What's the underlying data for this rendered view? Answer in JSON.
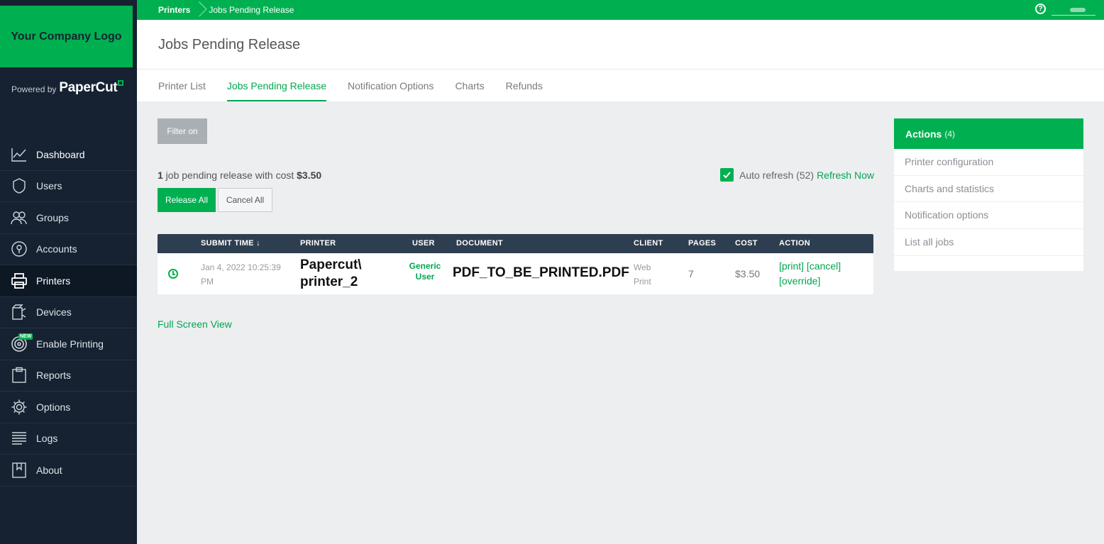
{
  "branding": {
    "logo_text": "Your Company Logo",
    "powered_by": "Powered by",
    "product": "PaperCut",
    "accent_color": "#00b050",
    "sidebar_color": "#162232"
  },
  "sidebar": {
    "items": [
      {
        "label": "Dashboard",
        "icon": "dashboard-chart-icon"
      },
      {
        "label": "Users",
        "icon": "user-shield-icon"
      },
      {
        "label": "Groups",
        "icon": "groups-icon"
      },
      {
        "label": "Accounts",
        "icon": "accounts-coin-icon"
      },
      {
        "label": "Printers",
        "icon": "printer-icon",
        "active": true
      },
      {
        "label": "Devices",
        "icon": "device-icon"
      },
      {
        "label": "Enable Printing",
        "icon": "target-icon",
        "badge": "NEW"
      },
      {
        "label": "Reports",
        "icon": "clipboard-icon"
      },
      {
        "label": "Options",
        "icon": "gear-icon"
      },
      {
        "label": "Logs",
        "icon": "list-lines-icon"
      },
      {
        "label": "About",
        "icon": "bookmark-icon"
      }
    ]
  },
  "topbar": {
    "breadcrumb_root": "Printers",
    "breadcrumb_current": "Jobs Pending Release",
    "help_icon": "?"
  },
  "header": {
    "title": "Jobs Pending Release"
  },
  "tabs": [
    {
      "label": "Printer List"
    },
    {
      "label": "Jobs Pending Release",
      "active": true
    },
    {
      "label": "Notification Options"
    },
    {
      "label": "Charts"
    },
    {
      "label": "Refunds"
    }
  ],
  "main": {
    "filter_label": "Filter on",
    "summary_count": "1",
    "summary_text": " job pending release with cost ",
    "summary_cost": "$3.50",
    "auto_refresh_label": "Auto refresh (52)",
    "refresh_now": "Refresh Now",
    "release_all": "Release All",
    "cancel_all": "Cancel All",
    "full_screen": "Full Screen View"
  },
  "table": {
    "columns": [
      "SUBMIT TIME ↓",
      "PRINTER",
      "USER",
      "DOCUMENT",
      "CLIENT",
      "PAGES",
      "COST",
      "ACTION"
    ],
    "rows": [
      {
        "submit_time": "Jan 4, 2022 10:25:39 PM",
        "printer": "Papercut\\ printer_2",
        "user": "Generic User",
        "document": "PDF_TO_BE_PRINTED.PDF",
        "client": "Web Print",
        "pages": "7",
        "cost": "$3.50",
        "actions": [
          "[print]",
          "[cancel]",
          "[override]"
        ]
      }
    ]
  },
  "actions_panel": {
    "title": "Actions",
    "count": "(4)",
    "items": [
      "Printer configuration",
      "Charts and statistics",
      "Notification options",
      "List all jobs"
    ]
  }
}
